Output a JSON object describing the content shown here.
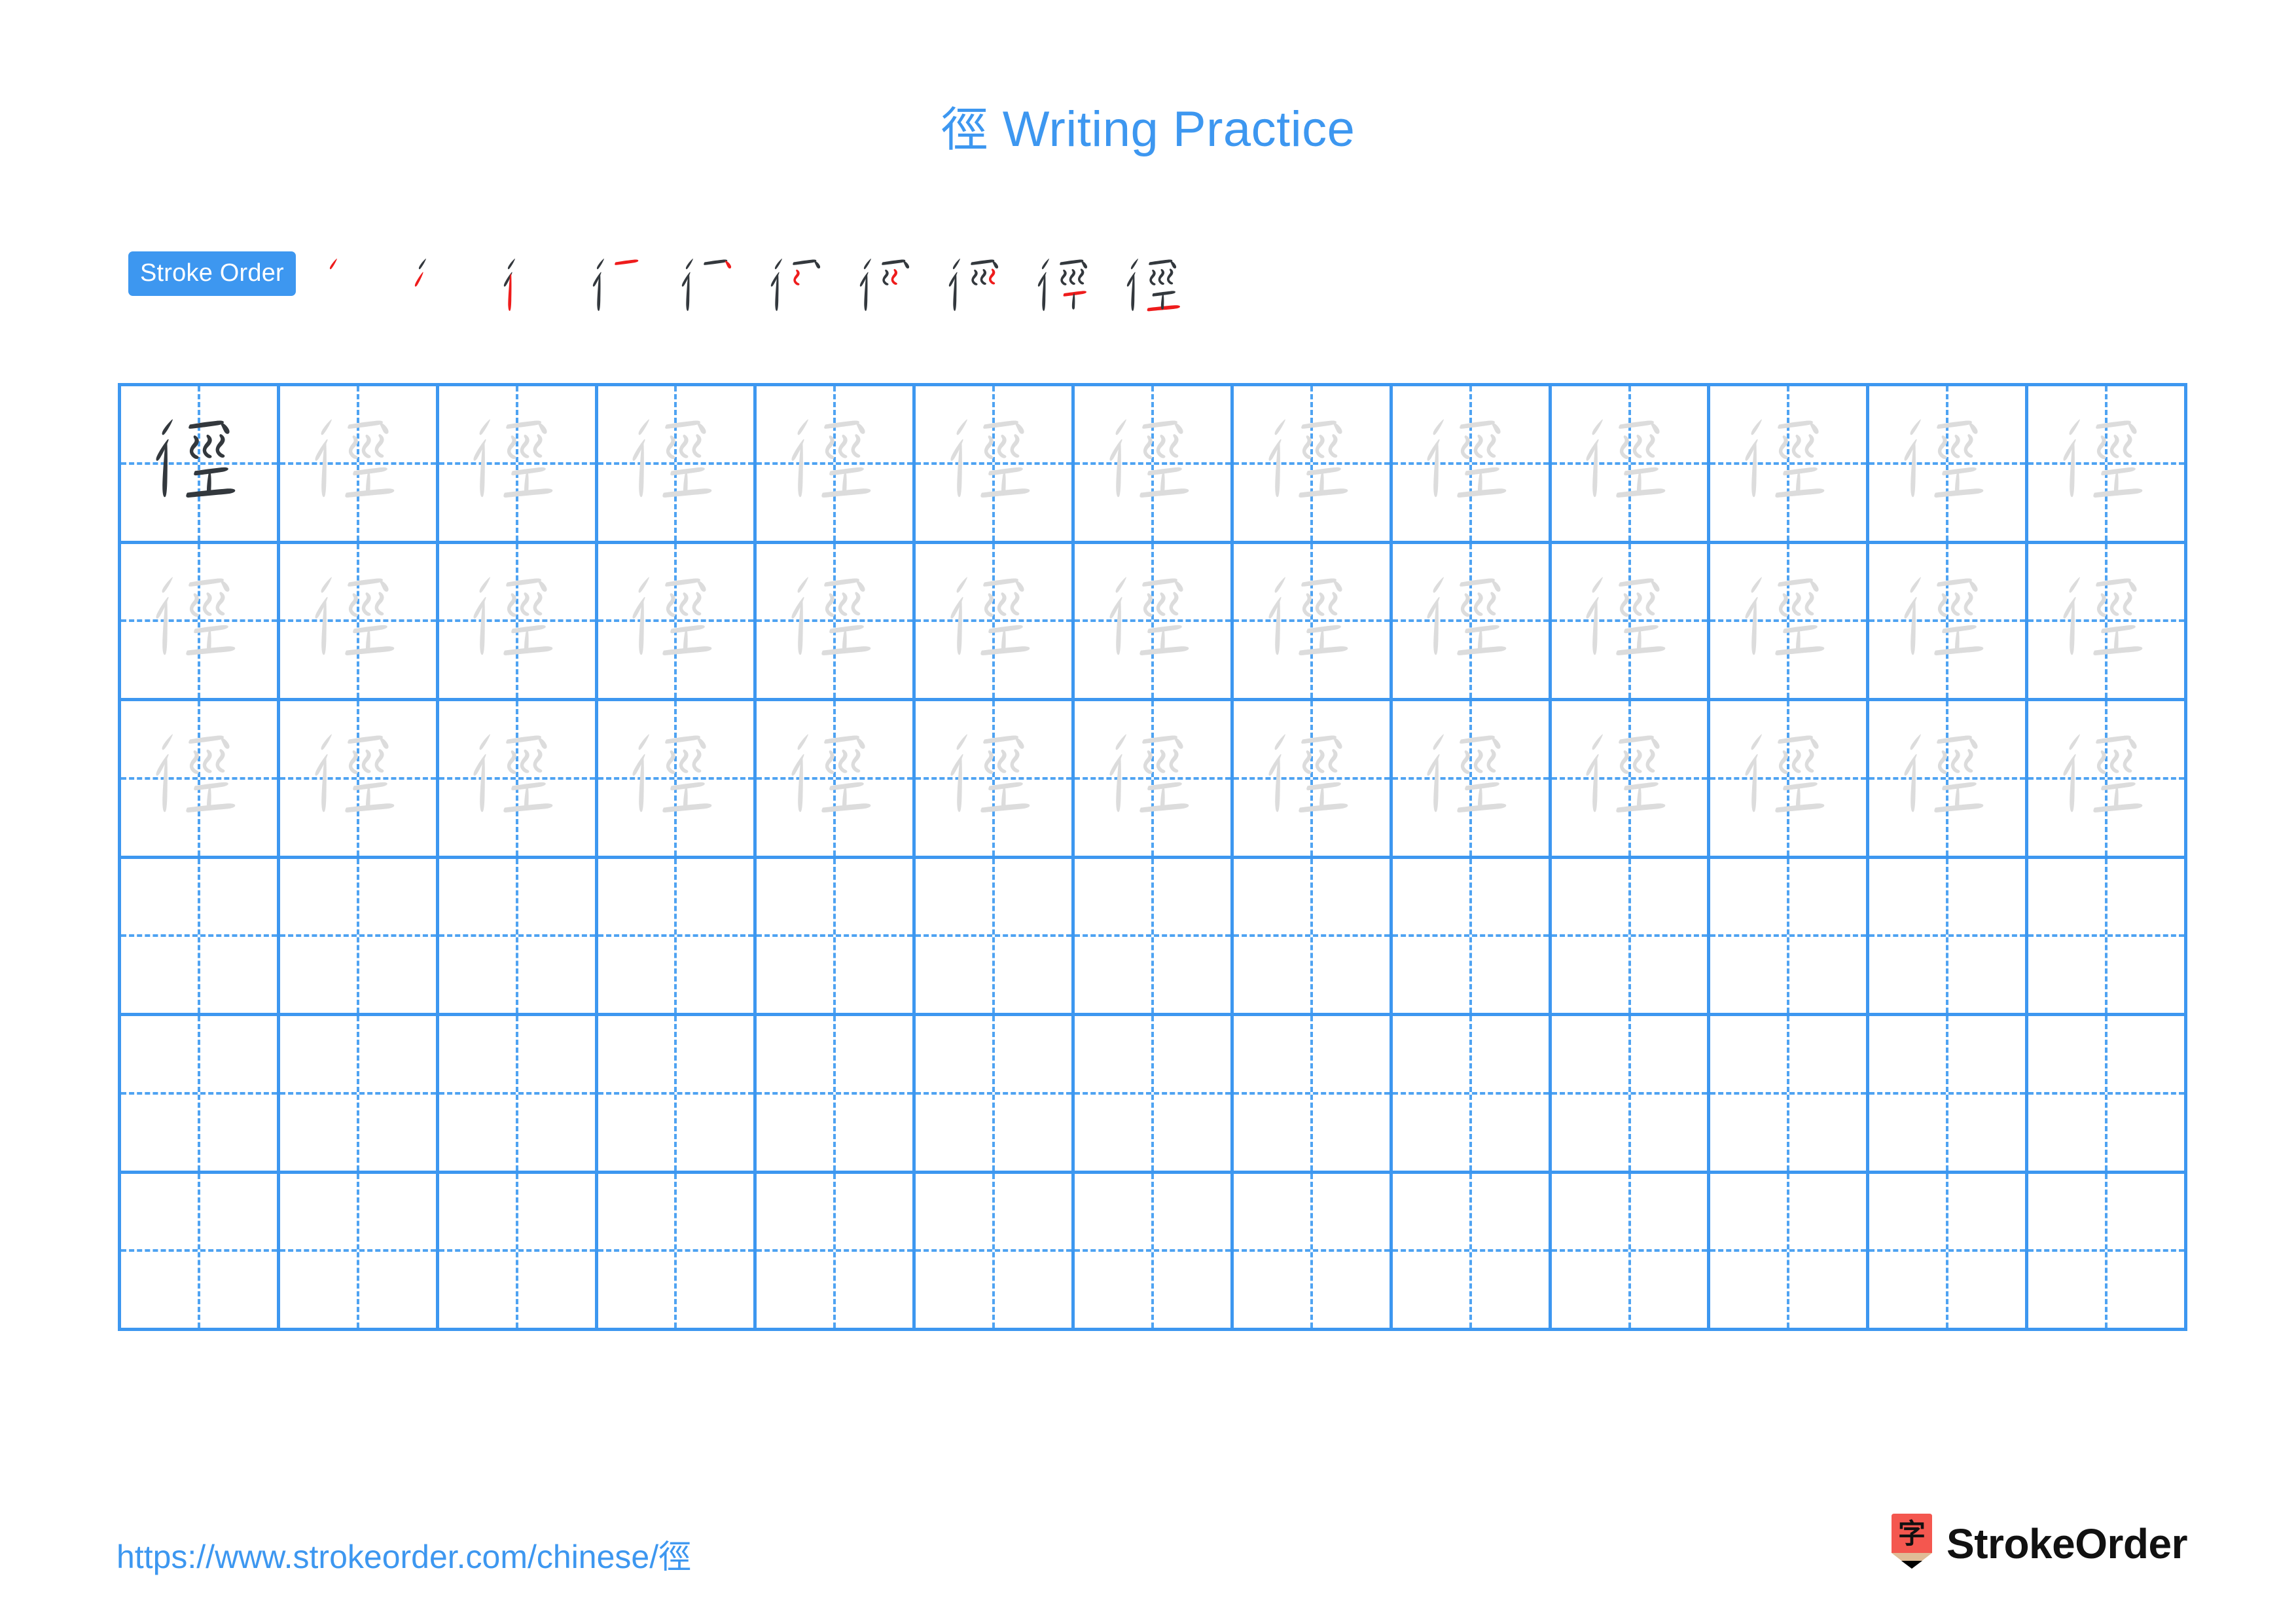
{
  "document": {
    "character": "徑",
    "title_text": "徑 Writing Practice",
    "title_character": "徑",
    "title_suffix": " Writing Practice",
    "title_color": "#3d97f0",
    "background_color": "#ffffff"
  },
  "stroke_order": {
    "badge_label": "Stroke Order",
    "badge_bg_color": "#3d97f0",
    "badge_text_color": "#ffffff",
    "stroke_count": 10,
    "existing_stroke_color": "#33383d",
    "new_stroke_color": "#ee1c1c",
    "steps": [
      {
        "step": 1,
        "strokes_shown": 1,
        "new_stroke_index": 1
      },
      {
        "step": 2,
        "strokes_shown": 2,
        "new_stroke_index": 2
      },
      {
        "step": 3,
        "strokes_shown": 3,
        "new_stroke_index": 3
      },
      {
        "step": 4,
        "strokes_shown": 4,
        "new_stroke_index": 4
      },
      {
        "step": 5,
        "strokes_shown": 5,
        "new_stroke_index": 5
      },
      {
        "step": 6,
        "strokes_shown": 6,
        "new_stroke_index": 6
      },
      {
        "step": 7,
        "strokes_shown": 7,
        "new_stroke_index": 7
      },
      {
        "step": 8,
        "strokes_shown": 8,
        "new_stroke_index": 8
      },
      {
        "step": 9,
        "strokes_shown": 9,
        "new_stroke_index": 9
      },
      {
        "step": 10,
        "strokes_shown": 10,
        "new_stroke_index": 10
      }
    ]
  },
  "practice_grid": {
    "columns": 13,
    "rows": 6,
    "grid_line_color": "#3d97f0",
    "guide_line_color": "#4fa3f2",
    "model_character_color": "#33383d",
    "trace_character_color": "#dcdcdc",
    "cells": [
      [
        "model",
        "trace",
        "trace",
        "trace",
        "trace",
        "trace",
        "trace",
        "trace",
        "trace",
        "trace",
        "trace",
        "trace",
        "trace"
      ],
      [
        "trace",
        "trace",
        "trace",
        "trace",
        "trace",
        "trace",
        "trace",
        "trace",
        "trace",
        "trace",
        "trace",
        "trace",
        "trace"
      ],
      [
        "trace",
        "trace",
        "trace",
        "trace",
        "trace",
        "trace",
        "trace",
        "trace",
        "trace",
        "trace",
        "trace",
        "trace",
        "trace"
      ],
      [
        "empty",
        "empty",
        "empty",
        "empty",
        "empty",
        "empty",
        "empty",
        "empty",
        "empty",
        "empty",
        "empty",
        "empty",
        "empty"
      ],
      [
        "empty",
        "empty",
        "empty",
        "empty",
        "empty",
        "empty",
        "empty",
        "empty",
        "empty",
        "empty",
        "empty",
        "empty",
        "empty"
      ],
      [
        "empty",
        "empty",
        "empty",
        "empty",
        "empty",
        "empty",
        "empty",
        "empty",
        "empty",
        "empty",
        "empty",
        "empty",
        "empty"
      ]
    ]
  },
  "footer": {
    "url": "https://www.strokeorder.com/chinese/徑",
    "url_color": "#3d97f0",
    "brand_name": "StrokeOrder",
    "brand_mark_character": "字",
    "brand_mark_body_color": "#f4574f",
    "brand_mark_wood_color": "#e0bc96",
    "brand_mark_tip_color": "#000000"
  }
}
